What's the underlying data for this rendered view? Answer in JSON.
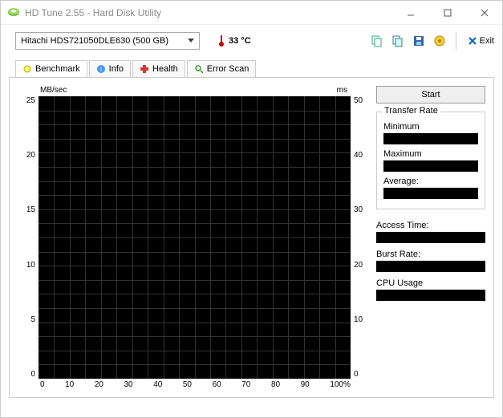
{
  "window": {
    "title": "HD Tune 2.55 - Hard Disk Utility"
  },
  "toolbar": {
    "drive": "Hitachi HDS721050DLE630 (500 GB)",
    "temperature": "33 °C",
    "exit_label": "Exit"
  },
  "tabs": {
    "benchmark": "Benchmark",
    "info": "Info",
    "health": "Health",
    "errorscan": "Error Scan"
  },
  "buttons": {
    "start": "Start"
  },
  "stats": {
    "transfer_group": "Transfer Rate",
    "minimum": "Minimum",
    "maximum": "Maximum",
    "average": "Average:",
    "access": "Access Time:",
    "burst": "Burst Rate:",
    "cpu": "CPU Usage"
  },
  "chart_data": {
    "type": "line",
    "y_left_label": "MB/sec",
    "y_right_label": "ms",
    "x_label_suffix": "%",
    "y_left_ticks": [
      "25",
      "20",
      "15",
      "10",
      "5",
      "0"
    ],
    "y_right_ticks": [
      "50",
      "40",
      "30",
      "20",
      "10",
      "0"
    ],
    "x_ticks": [
      "0",
      "10",
      "20",
      "30",
      "40",
      "50",
      "60",
      "70",
      "80",
      "90",
      "100%"
    ],
    "series": []
  }
}
